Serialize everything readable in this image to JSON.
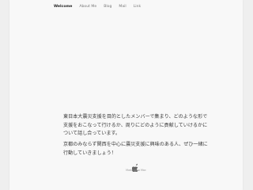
{
  "nav": {
    "items": [
      {
        "label": "Welcome",
        "active": true
      },
      {
        "label": "About Me",
        "active": false
      },
      {
        "label": "Blog",
        "active": false
      },
      {
        "label": "Mail",
        "active": false
      },
      {
        "label": "Link",
        "active": false
      }
    ]
  },
  "hero": {
    "title": ""
  },
  "content": {
    "paragraph1": "東日本大震災支援を目的としたメンバーで集まり、どのような形で支援をおこなって行けるか、周りにどのように貢献していけるかについて話し合っています。",
    "paragraph2": "京都のみならず関西を中心に震災支援に興味のある人、ぜひ一緒に行動していきましょう！"
  },
  "footer": {
    "icon": "apple-logo-icon",
    "text": "Made on a Mac"
  },
  "colors": {
    "background": "#efefef",
    "card": "#f8f8f8",
    "nav_active": "#222222",
    "nav_inactive": "#777777",
    "text": "#3a3a3a"
  }
}
